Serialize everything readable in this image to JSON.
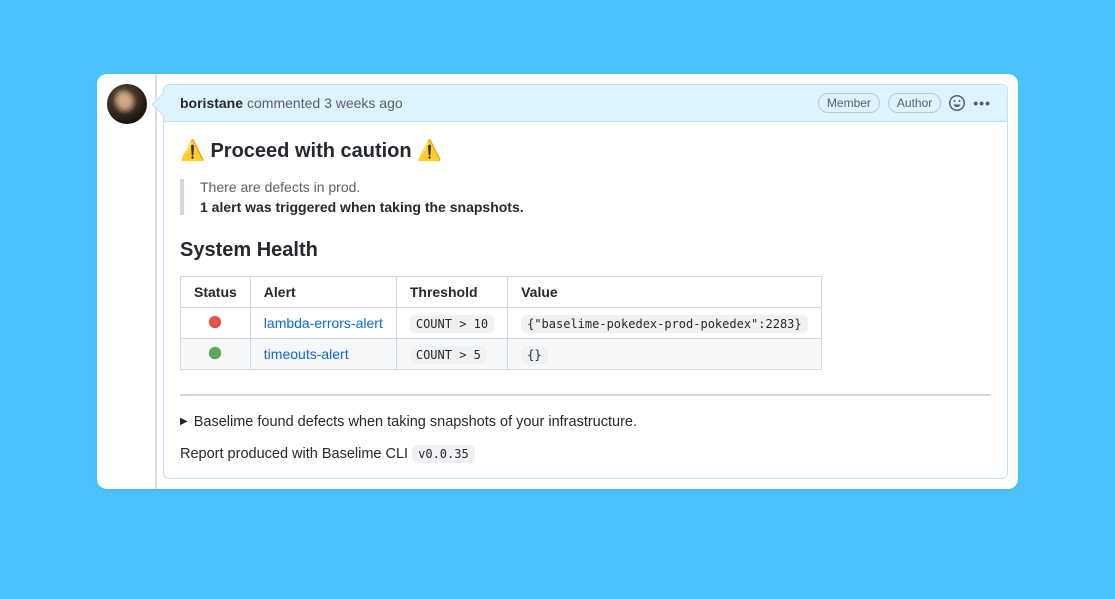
{
  "comment": {
    "author": "boristane",
    "action": "commented",
    "time": "3 weeks ago",
    "badges": [
      "Member",
      "Author"
    ]
  },
  "content": {
    "warn_prefix": "⚠️",
    "warn_text": "Proceed with caution",
    "warn_suffix": "⚠️",
    "blockquote": {
      "line1": "There are defects in prod.",
      "line2": "1 alert was triggered when taking the snapshots."
    },
    "system_health_heading": "System Health",
    "table": {
      "headers": [
        "Status",
        "Alert",
        "Threshold",
        "Value"
      ],
      "rows": [
        {
          "status": "red",
          "alert": "lambda-errors-alert",
          "threshold": "COUNT > 10",
          "value": "{\"baselime-pokedex-prod-pokedex\":2283}"
        },
        {
          "status": "green",
          "alert": "timeouts-alert",
          "threshold": "COUNT > 5",
          "value": "{}"
        }
      ]
    },
    "details_summary": "Baselime found defects when taking snapshots of your infrastructure.",
    "report_text": "Report produced with Baselime CLI",
    "report_version": "v0.0.35"
  }
}
